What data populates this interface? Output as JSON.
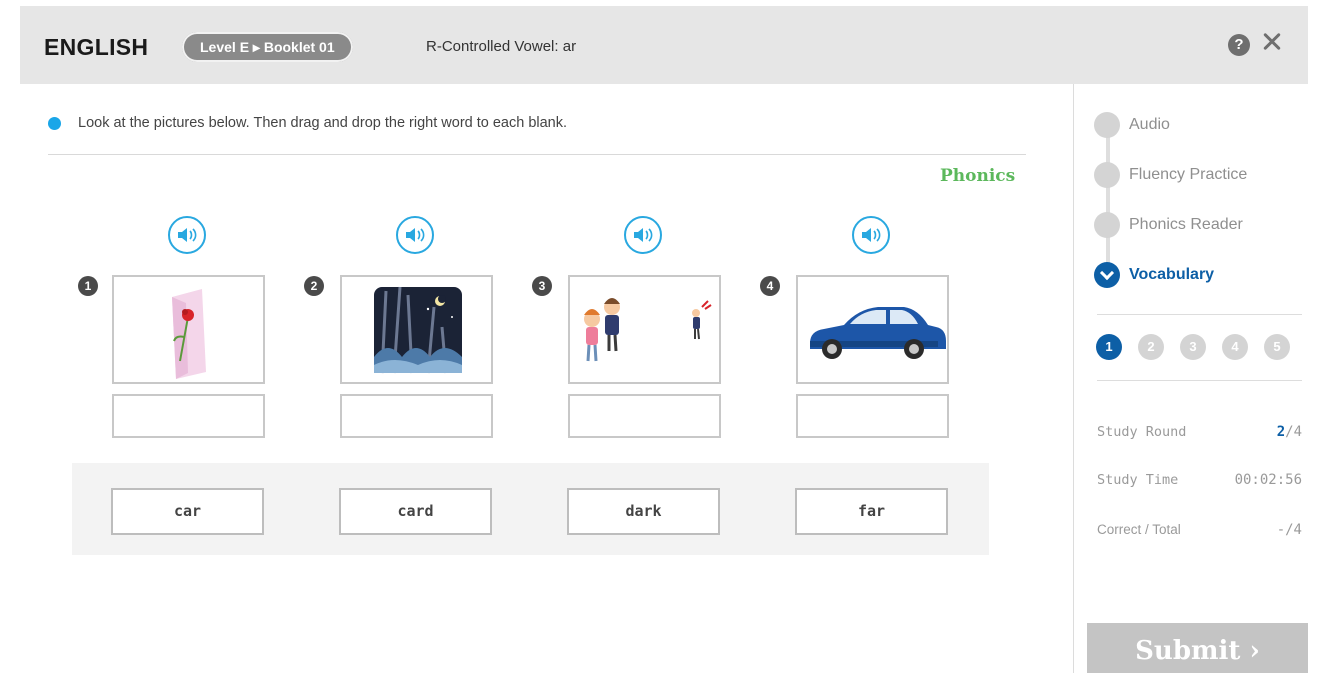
{
  "header": {
    "brand": "ENGLISH",
    "level_pill": "Level E ▸ Booklet 01",
    "subtitle": "R-Controlled Vowel: ar",
    "help_icon": "?"
  },
  "instruction": "Look at the pictures below. Then drag and drop the right word to each blank.",
  "section_label": "Phonics",
  "questions": [
    {
      "number": "1",
      "picture": "card-with-flower"
    },
    {
      "number": "2",
      "picture": "dark-night-forest"
    },
    {
      "number": "3",
      "picture": "children-far-away"
    },
    {
      "number": "4",
      "picture": "blue-car"
    }
  ],
  "word_bank": [
    "car",
    "card",
    "dark",
    "far"
  ],
  "sidebar": {
    "steps": [
      {
        "label": "Audio",
        "state": "inactive"
      },
      {
        "label": "Fluency Practice",
        "state": "inactive"
      },
      {
        "label": "Phonics Reader",
        "state": "inactive"
      },
      {
        "label": "Vocabulary",
        "state": "active"
      }
    ],
    "pages": [
      "1",
      "2",
      "3",
      "4",
      "5"
    ],
    "active_page": "1",
    "stats": {
      "round_label": "Study Round",
      "round_current": "2",
      "round_total": "/4",
      "time_label": "Study Time",
      "time_value": "00:02:56",
      "correct_label": "Correct / Total",
      "correct_value": "-/4"
    },
    "submit_label": "Submit ›"
  },
  "colors": {
    "accent_blue": "#0d5fa6",
    "audio_blue": "#29a8e0",
    "phonics_green": "#5cb85c",
    "header_bg": "#e6e6e6"
  }
}
